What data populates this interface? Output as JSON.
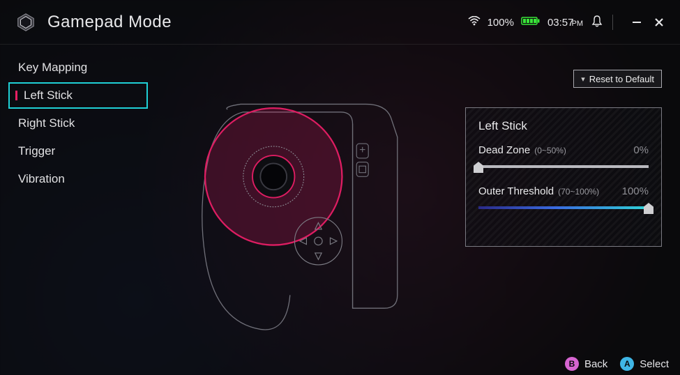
{
  "header": {
    "title": "Gamepad Mode",
    "battery_percent": "100%",
    "time": "03:57",
    "time_suffix": "PM"
  },
  "sidebar": {
    "items": [
      {
        "label": "Key Mapping",
        "active": false
      },
      {
        "label": "Left Stick",
        "active": true
      },
      {
        "label": "Right Stick",
        "active": false
      },
      {
        "label": "Trigger",
        "active": false
      },
      {
        "label": "Vibration",
        "active": false
      }
    ]
  },
  "reset_button": {
    "label": "Reset to Default"
  },
  "panel": {
    "title": "Left Stick",
    "deadzone": {
      "label": "Dead Zone",
      "range_hint": "(0~50%)",
      "value_label": "0%",
      "value": 0,
      "min": 0,
      "max": 50
    },
    "outer": {
      "label": "Outer Threshold",
      "range_hint": "(70~100%)",
      "value_label": "100%",
      "value": 100,
      "min": 70,
      "max": 100
    }
  },
  "footer": {
    "back": {
      "key": "B",
      "label": "Back"
    },
    "select": {
      "key": "A",
      "label": "Select"
    }
  },
  "colors": {
    "accent_cyan": "#1fd0d6",
    "accent_magenta": "#e91e63",
    "highlight_ring": "#de1d62"
  }
}
